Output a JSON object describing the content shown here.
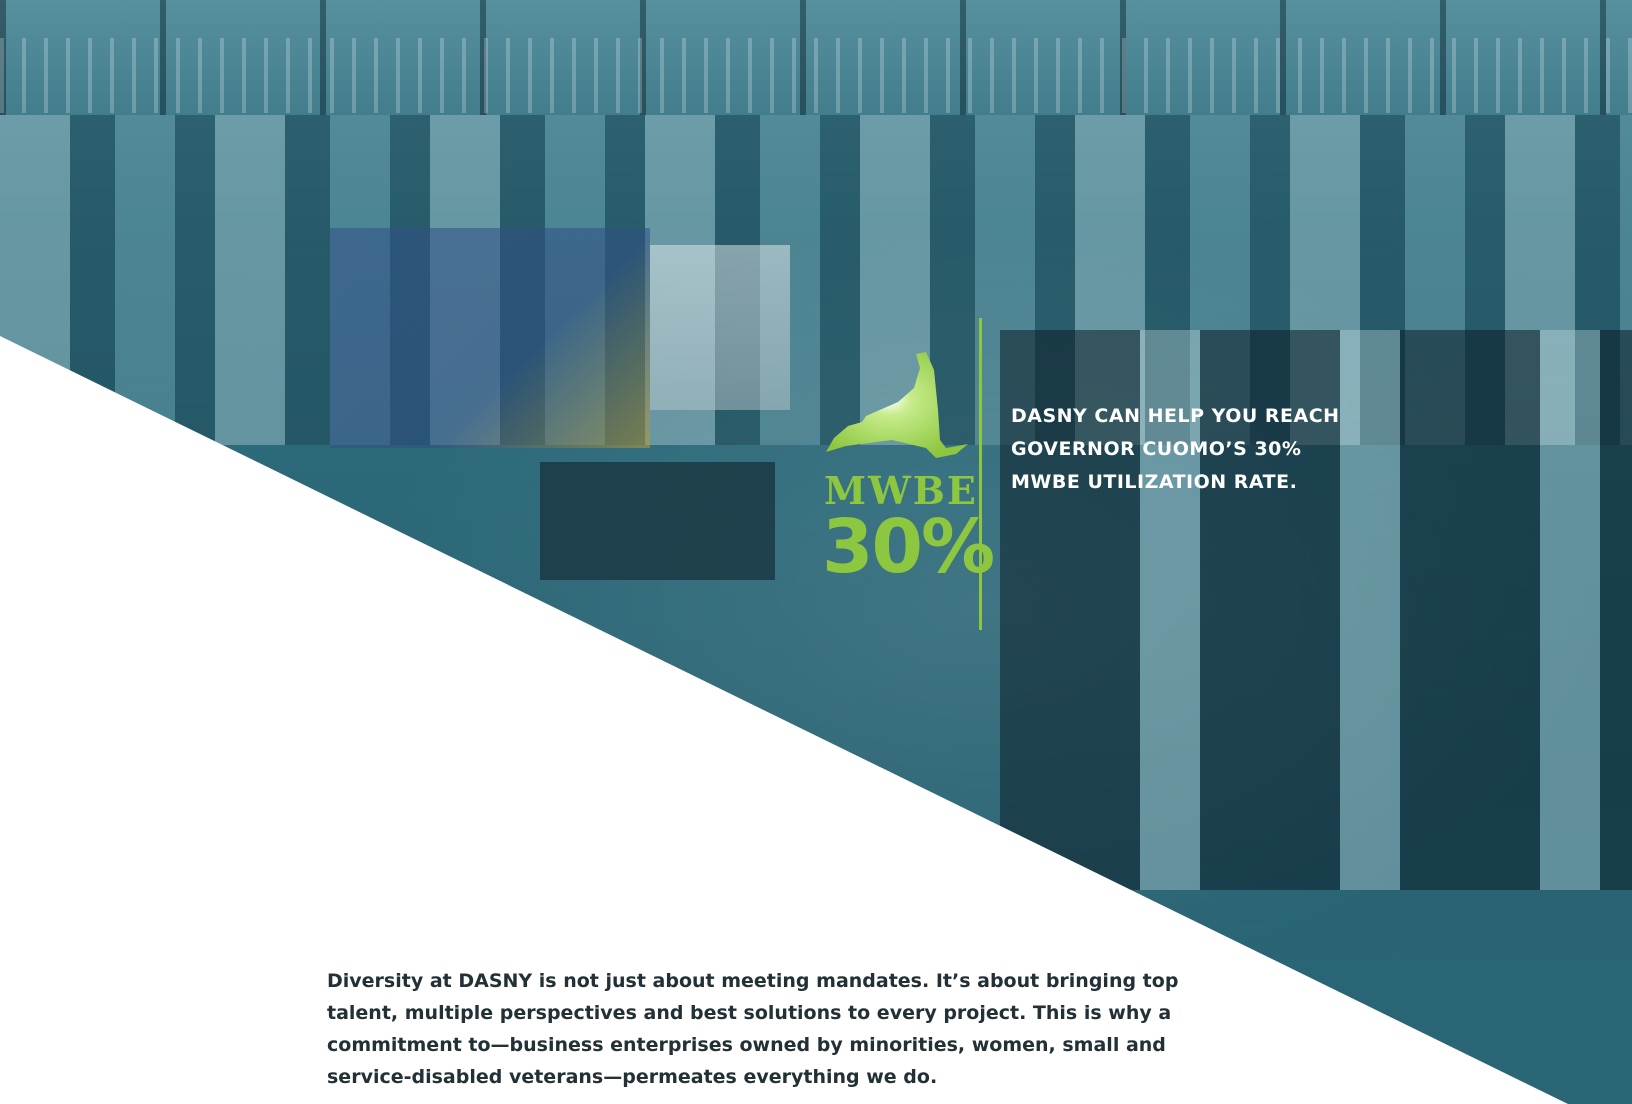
{
  "badge": {
    "word": "MWBE",
    "percent": "30%",
    "accent_color": "#8dc63f",
    "icon": "new-york-state-map-icon"
  },
  "callout": {
    "text": "DASNY can help you reach Governor Cuomo’s 30% MWBE utilization rate."
  },
  "body": {
    "paragraph": "Diversity at DASNY is not just about meeting mandates. It’s about bringing top talent, multiple perspectives and best solutions to every project. This is why a commitment to—business enterprises owned by minorities, women, small and service-disabled veterans—permeates everything we do."
  },
  "colors": {
    "photo_tint": "#2b6878",
    "body_text": "#233036"
  }
}
